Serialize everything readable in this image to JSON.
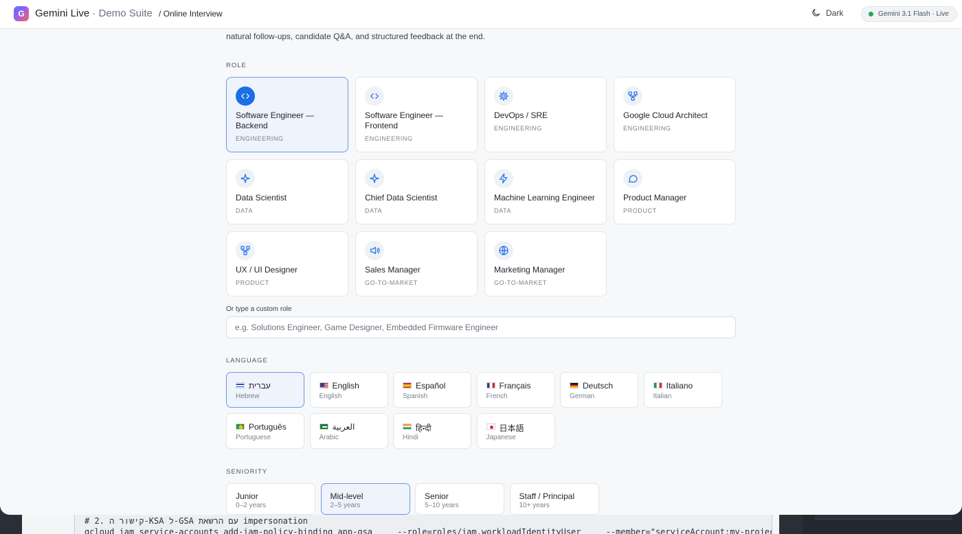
{
  "header": {
    "logo_letter": "G",
    "brand": "Gemini Live",
    "brand_sub": " · Demo Suite",
    "breadcrumb": "/ Online Interview",
    "theme_label": "Dark",
    "model_status": "Gemini 3.1 Flash · Live"
  },
  "intro_text": "natural follow-ups, candidate Q&A, and structured feedback at the end.",
  "role_section": {
    "label": "ROLE",
    "roles": [
      {
        "title": "Software Engineer — Backend",
        "category": "ENGINEERING",
        "icon": "code-icon",
        "selected": true
      },
      {
        "title": "Software Engineer — Frontend",
        "category": "ENGINEERING",
        "icon": "code-icon",
        "selected": false
      },
      {
        "title": "DevOps / SRE",
        "category": "ENGINEERING",
        "icon": "gear-icon",
        "selected": false
      },
      {
        "title": "Google Cloud Architect",
        "category": "ENGINEERING",
        "icon": "hierarchy-icon",
        "selected": false
      },
      {
        "title": "Data Scientist",
        "category": "DATA",
        "icon": "sparkle-icon",
        "selected": false
      },
      {
        "title": "Chief Data Scientist",
        "category": "DATA",
        "icon": "sparkle-icon",
        "selected": false
      },
      {
        "title": "Machine Learning Engineer",
        "category": "DATA",
        "icon": "bolt-icon",
        "selected": false
      },
      {
        "title": "Product Manager",
        "category": "PRODUCT",
        "icon": "chat-bubble-icon",
        "selected": false
      },
      {
        "title": "UX / UI Designer",
        "category": "PRODUCT",
        "icon": "hierarchy-icon",
        "selected": false
      },
      {
        "title": "Sales Manager",
        "category": "GO-TO-MARKET",
        "icon": "megaphone-icon",
        "selected": false
      },
      {
        "title": "Marketing Manager",
        "category": "GO-TO-MARKET",
        "icon": "globe-icon",
        "selected": false
      }
    ],
    "custom_label": "Or type a custom role",
    "custom_placeholder": "e.g. Solutions Engineer, Game Designer, Embedded Firmware Engineer"
  },
  "language_section": {
    "label": "LANGUAGE",
    "languages": [
      {
        "native": "עברית",
        "english": "Hebrew",
        "flag": "il-flag-icon",
        "selected": true
      },
      {
        "native": "English",
        "english": "English",
        "flag": "us-flag-icon",
        "selected": false
      },
      {
        "native": "Español",
        "english": "Spanish",
        "flag": "es-flag-icon",
        "selected": false
      },
      {
        "native": "Français",
        "english": "French",
        "flag": "fr-flag-icon",
        "selected": false
      },
      {
        "native": "Deutsch",
        "english": "German",
        "flag": "de-flag-icon",
        "selected": false
      },
      {
        "native": "Italiano",
        "english": "Italian",
        "flag": "it-flag-icon",
        "selected": false
      },
      {
        "native": "Português",
        "english": "Portuguese",
        "flag": "br-flag-icon",
        "selected": false
      },
      {
        "native": "العربية",
        "english": "Arabic",
        "flag": "sa-flag-icon",
        "selected": false
      },
      {
        "native": "हिन्दी",
        "english": "Hindi",
        "flag": "in-flag-icon",
        "selected": false
      },
      {
        "native": "日本語",
        "english": "Japanese",
        "flag": "jp-flag-icon",
        "selected": false
      }
    ]
  },
  "seniority_section": {
    "label": "SENIORITY",
    "levels": [
      {
        "level": "Junior",
        "years": "0–2 years",
        "selected": false
      },
      {
        "level": "Mid-level",
        "years": "2–5 years",
        "selected": true
      },
      {
        "level": "Senior",
        "years": "5–10 years",
        "selected": false
      },
      {
        "level": "Staff / Principal",
        "years": "10+ years",
        "selected": false
      }
    ]
  },
  "background_code": {
    "line1": "# 2. קישור ה-KSA ל-GSA עם הרשאת impersonation",
    "line2": "gcloud iam service-accounts add-iam-policy-binding app-gsa     --role=roles/iam.workloadIdentityUser     --member=\"serviceAccount:my-project.svc.id.goog"
  }
}
